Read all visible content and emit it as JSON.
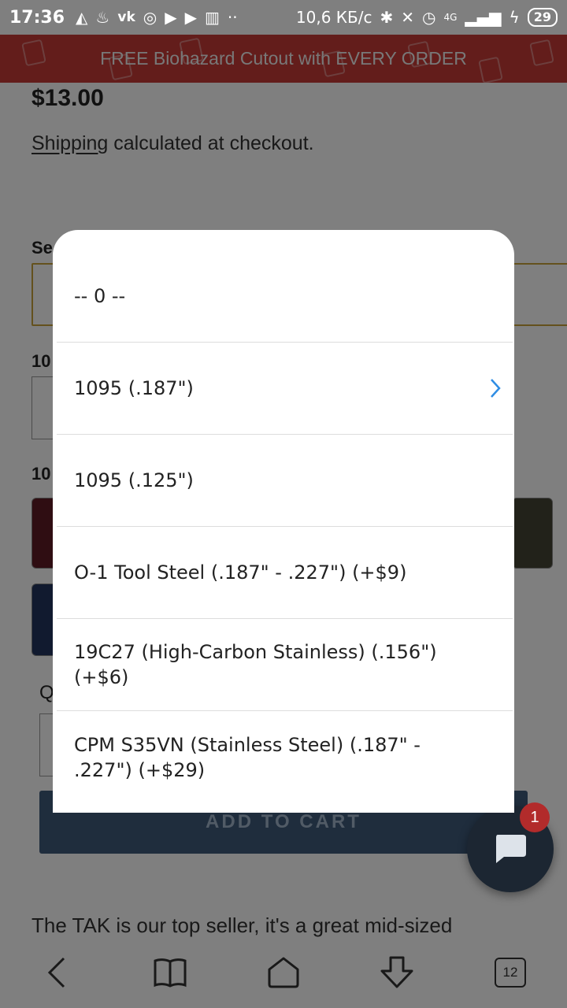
{
  "status_bar": {
    "time": "17:36",
    "speed": "10,6 КБ/с",
    "network": "4G",
    "battery": "29",
    "icons": [
      "navigation-icon",
      "fire-icon",
      "vk-icon",
      "instagram-icon",
      "youtube-icon",
      "youtube-icon",
      "trash-icon",
      "more-dots-icon",
      "bluetooth-icon",
      "mute-icon",
      "alarm-icon",
      "signal-icon",
      "charging-icon"
    ]
  },
  "banner": {
    "text": "FREE Biohazard Cutout with EVERY ORDER",
    "color": "#c63a36"
  },
  "product": {
    "price": "$13.00",
    "shipping_link": "Shipping",
    "shipping_rest": " calculated at checkout.",
    "select_label": "Se",
    "label_2": "10",
    "label_3": "10",
    "qty_label": "Q",
    "add_to_cart": "ADD TO CART",
    "description": "The TAK is our top seller, it's a great mid-sized"
  },
  "picker": {
    "options": [
      {
        "label": "-- 0 --",
        "selected": false
      },
      {
        "label": "1095 (.187\")",
        "selected": true
      },
      {
        "label": "1095 (.125\")",
        "selected": false
      },
      {
        "label": "O-1 Tool Steel (.187\" - .227\") (+$9)",
        "selected": false
      },
      {
        "label": "19C27 (High-Carbon Stainless) (.156\") (+$6)",
        "selected": false
      },
      {
        "label": "CPM S35VN (Stainless Steel) (.187\" - .227\") (+$29)",
        "selected": false
      }
    ],
    "accent": "#2f8de4"
  },
  "chat": {
    "badge_count": "1"
  },
  "bottom_bar": {
    "tab_count": "12",
    "icons": [
      "back-icon",
      "bookmarks-icon",
      "home-icon",
      "download-icon",
      "tabs-icon"
    ]
  }
}
